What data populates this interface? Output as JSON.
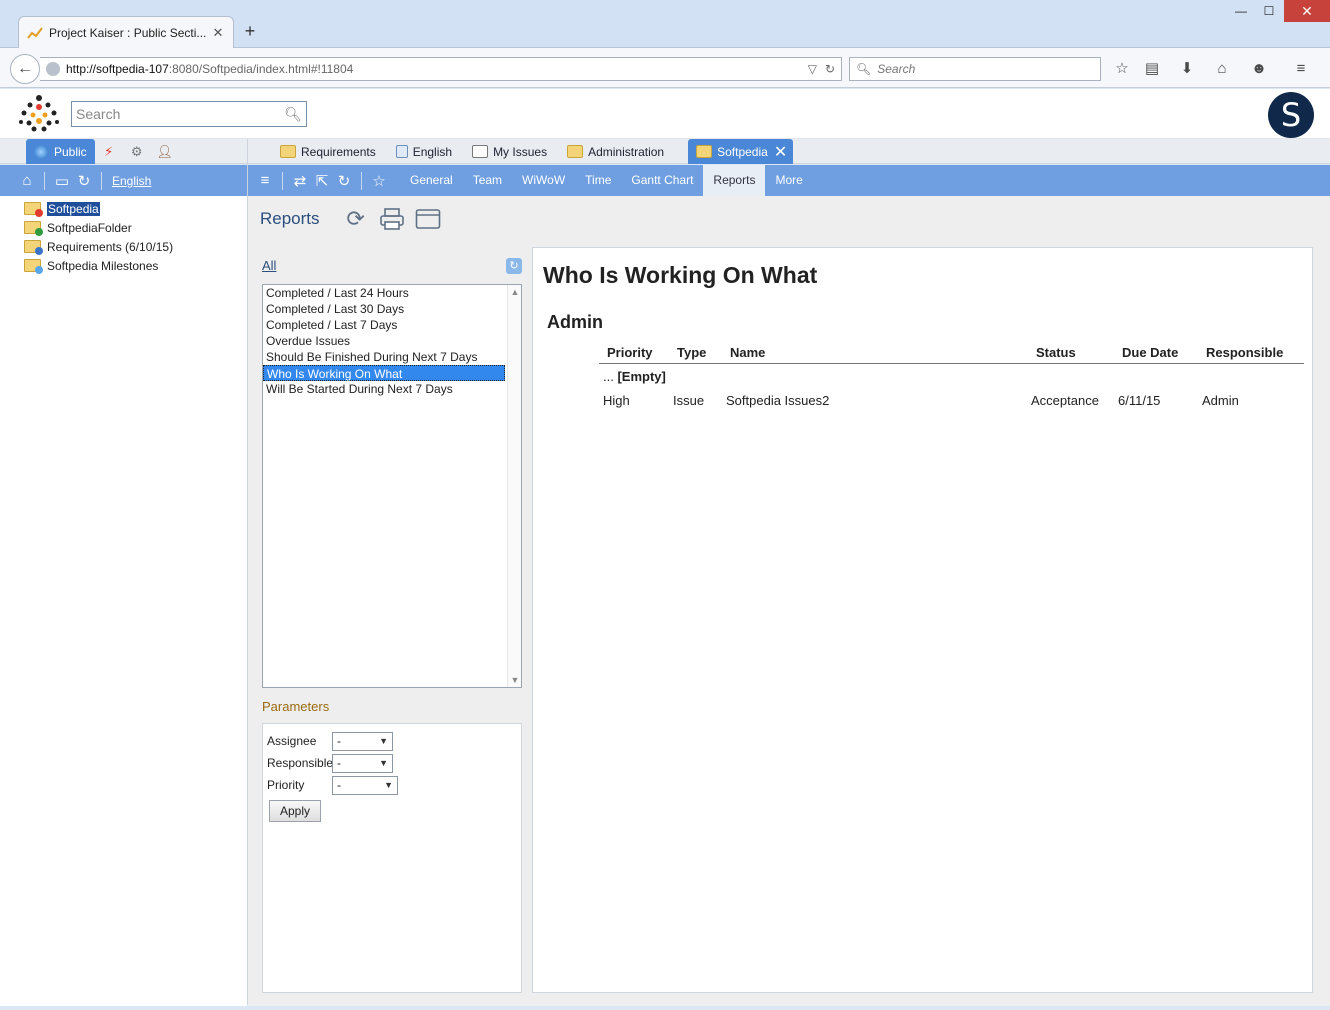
{
  "browser": {
    "tab_title": "Project Kaiser : Public Secti...",
    "new_tab": "+",
    "url_host": "http://softpedia-107",
    "url_rest": ":8080/Softpedia/index.html#!11804",
    "search_placeholder": "Search",
    "window": {
      "minimize": "—",
      "maximize": "☐",
      "close": "✕"
    }
  },
  "app": {
    "search_placeholder": "Search",
    "avatar_letter": "S"
  },
  "top_tabs": {
    "public": "Public",
    "items": [
      {
        "label": "Requirements",
        "icon": "requirements-folder-icon"
      },
      {
        "label": "English",
        "icon": "language-doc-icon"
      },
      {
        "label": "My Issues",
        "icon": "my-issues-icon"
      },
      {
        "label": "Administration",
        "icon": "folder-icon"
      }
    ],
    "active": {
      "label": "Softpedia",
      "icon": "softpedia-project-icon"
    }
  },
  "left_toolbar": {
    "language_link": "English"
  },
  "view_tabs": [
    "General",
    "Team",
    "WiWoW",
    "Time",
    "Gantt Chart",
    "Reports",
    "More"
  ],
  "view_tabs_active": "Reports",
  "tree": [
    {
      "label": "Softpedia",
      "icon": "red",
      "selected": true
    },
    {
      "label": "SoftpediaFolder",
      "icon": "green",
      "selected": false
    },
    {
      "label": "Requirements  (6/10/15)",
      "icon": "blue",
      "selected": false
    },
    {
      "label": "Softpedia Milestones",
      "icon": "sky",
      "selected": false
    }
  ],
  "reports": {
    "title": "Reports",
    "all_link": "All",
    "list": [
      "Completed / Last 24 Hours",
      "Completed / Last 30 Days",
      "Completed / Last 7 Days",
      "Overdue Issues",
      "Should Be Finished During Next 7 Days",
      "Who Is Working On What",
      "Will Be Started During Next 7 Days"
    ],
    "selected_index": 5
  },
  "parameters": {
    "title": "Parameters",
    "fields": [
      {
        "label": "Assignee",
        "value": "-"
      },
      {
        "label": "Responsible",
        "value": "-"
      },
      {
        "label": "Priority",
        "value": "-"
      }
    ],
    "apply": "Apply"
  },
  "report": {
    "title": "Who Is Working On What",
    "group": "Admin",
    "columns": [
      "Priority",
      "Type",
      "Name",
      "Status",
      "Due Date",
      "Responsible"
    ],
    "subgroup_prefix": "...",
    "subgroup": "[Empty]",
    "rows": [
      [
        "High",
        "Issue",
        "Softpedia Issues2",
        "Acceptance",
        "6/11/15",
        "Admin"
      ]
    ]
  }
}
